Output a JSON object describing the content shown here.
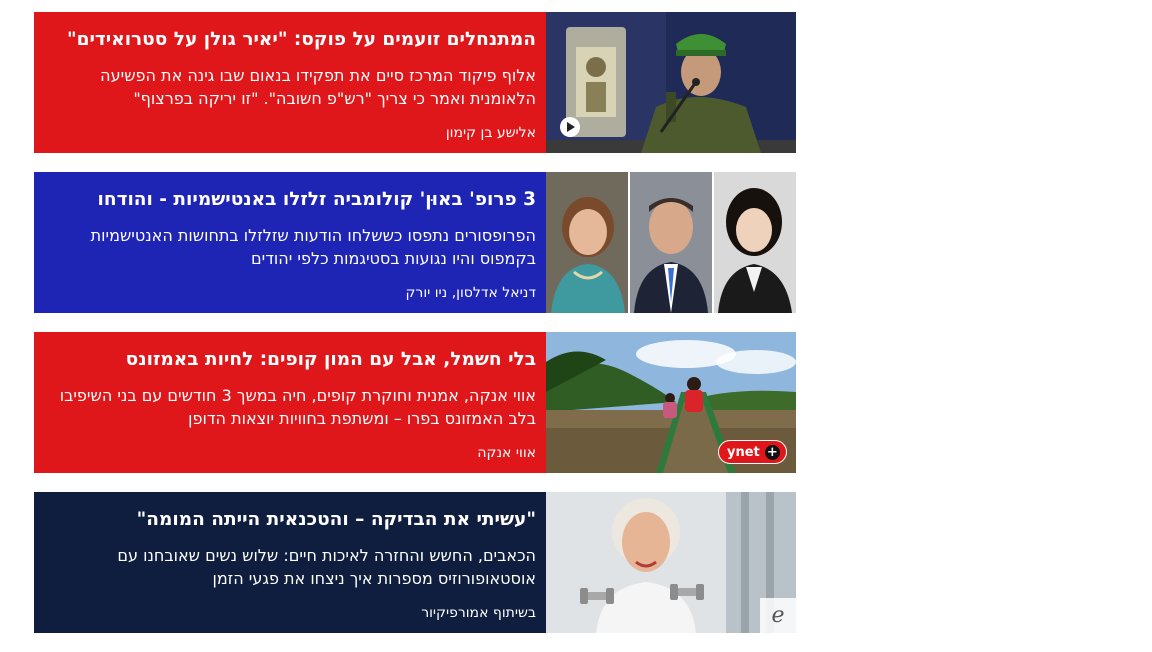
{
  "colors": {
    "red": "#e0171a",
    "blue": "#1e24b3",
    "navy": "#0f1e3f",
    "text": "#ffffff"
  },
  "articles": [
    {
      "title": "המתנחלים זועמים על פוקס: \"יאיר גולן על סטרואידים\"",
      "subtitle": "אלוף פיקוד המרכז סיים את תפקידו בנאום שבו גינה את הפשיעה הלאומנית ואמר כי צריך \"רש\"פ חשובה\". \"זו יריקה בפרצוף\"",
      "author": "אלישע בן קימון",
      "color": "#e0171a",
      "badge": "play-icon"
    },
    {
      "title": "3 פרופ' באוּן' קולומביה זלזלו באנטישמיות - והודחו",
      "subtitle": "הפרופסורים נתפסו כששלחו הודעות שזלזלו בתחושות האנטישמיות בקמפוס והיו נגועות בסטיגמות כלפי יהודים",
      "author": "דניאל אדלסון, ניו יורק",
      "color": "#1e24b3",
      "badge": ""
    },
    {
      "title": "בלי חשמל, אבל עם המון קופים: לחיות באמזונס",
      "subtitle": "אווי אנקה, אמנית וחוקרת קופים, חיה במשך 3 חודשים עם בני השיפיבו בלב האמזונס בפרו – ומשתפת בחוויות יוצאות הדופן",
      "author": "אווי אנקה",
      "color": "#e0171a",
      "badge": "ynet",
      "badge_plus": "+"
    },
    {
      "title": "\"עשיתי את הבדיקה – והטכנאית הייתה המומה\"",
      "subtitle": "הכאבים, החשש והחזרה לאיכות חיים: שלוש נשים שאובחנו עם אוסטאופורוזיס מספרות איך ניצחו את פגעי הזמן",
      "author": "בשיתוף אמורפיקיור",
      "color": "#0f1e3f",
      "badge": "e"
    }
  ]
}
